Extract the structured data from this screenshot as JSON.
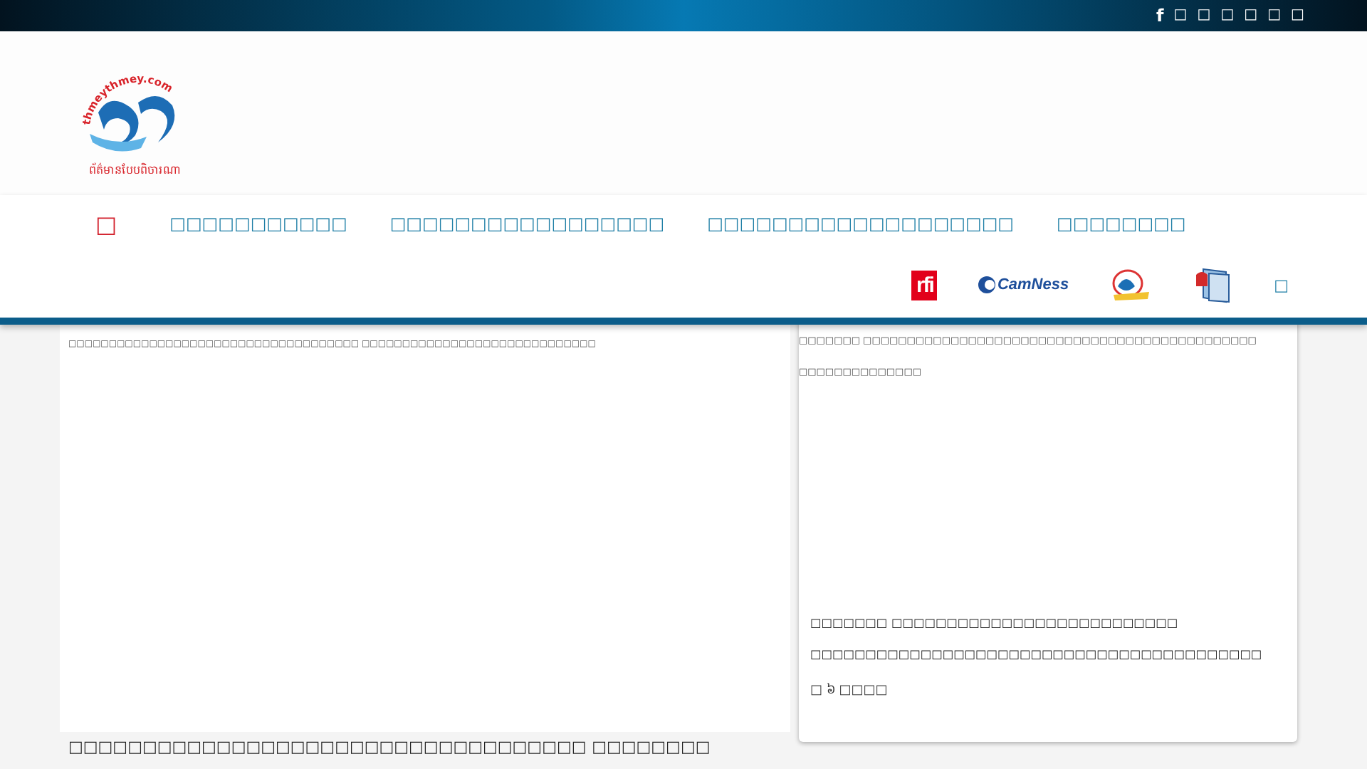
{
  "top_bar": {
    "social_icons": [
      "f",
      "□",
      "□",
      "□",
      "□",
      "□",
      "□"
    ]
  },
  "logo": {
    "domain": "thmeythmey.com",
    "tagline": "ព័ត៌មានបែបពិចារណា"
  },
  "nav": {
    "home_icon": "□",
    "items": [
      "□□□□□□□□□□□",
      "□□□□□□□□□□□□□□□□□",
      "□□□□□□□□□□□□□□□□□□□",
      "□□□□□□□□"
    ],
    "partners": [
      {
        "kind": "rfi",
        "label": "rfi"
      },
      {
        "kind": "camness",
        "label": "CamNess"
      },
      {
        "kind": "anniversary"
      },
      {
        "kind": "book"
      }
    ],
    "more_icon": "□"
  },
  "featured": {
    "image_alt": "□□□□□□□□□□□□□□□□□□□□□□□□□□□□□□□□□□□□ □□□□□□□□□□□□□□□□□□□□□□□□□□□□□",
    "headline": "□□□□□□□□□□□□□□□□□□□□□□□□□□□□□□□□□□□ □□□□□□□□"
  },
  "side_card": {
    "image_alt": "□□□□□□□ □□□□□□□□□□□□□□□□□□□□□□□□□□□□□□□□□□□□□□□□□□□□□ □□□□□□□□□□□□□□",
    "title": "□□□□□□□ □□□□□□□□□□□□□□□□□□□□□□□□□□ □□□□□□□□□□□□□□□□□□□□□□□□□□□□□□□□□□□□□□□□□",
    "meta": "□ ៦ □□□□"
  }
}
